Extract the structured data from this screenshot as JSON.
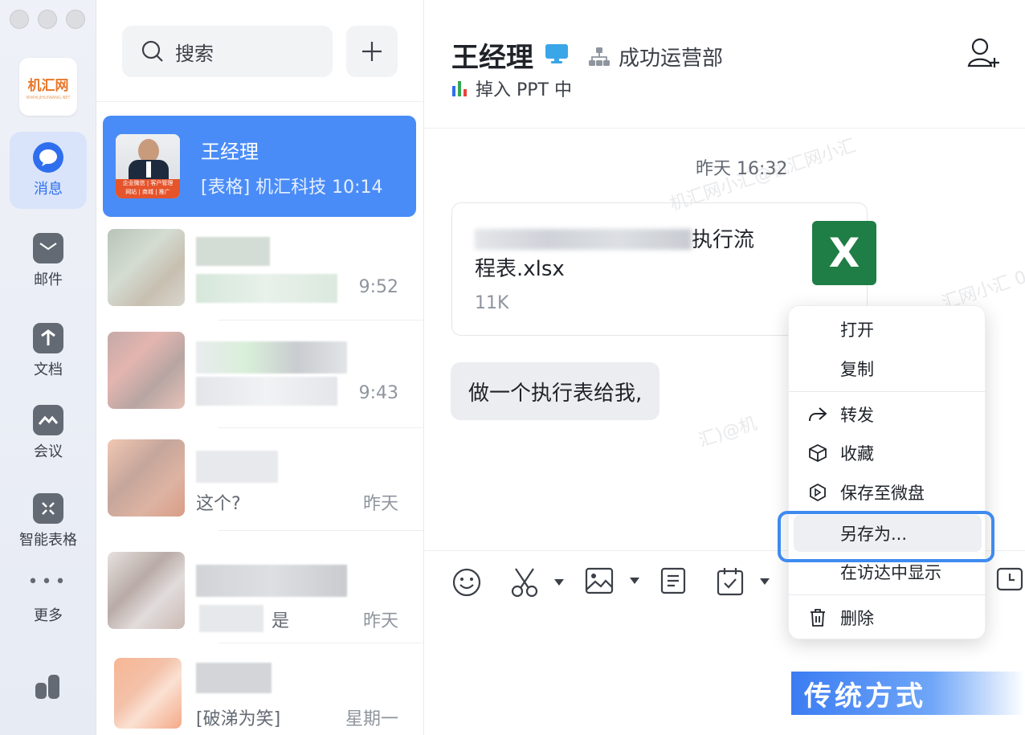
{
  "nav": {
    "logo_text": "机汇网",
    "logo_sub": "WWW.JIHUIWANG.NET",
    "items": [
      {
        "label": "消息",
        "icon": "chat-bubble-icon"
      },
      {
        "label": "邮件",
        "icon": "mail-icon"
      },
      {
        "label": "文档",
        "icon": "document-icon"
      },
      {
        "label": "会议",
        "icon": "meeting-icon"
      },
      {
        "label": "智能表格",
        "icon": "smart-sheet-icon"
      },
      {
        "label": "更多",
        "icon": "more-icon"
      }
    ]
  },
  "list": {
    "search_label": "搜索",
    "conversations": [
      {
        "name": "王经理",
        "preview": "[表格] 机汇科技 10:14",
        "time": ""
      },
      {
        "name": "",
        "preview": "",
        "time": "9:52"
      },
      {
        "name": "",
        "preview": "",
        "time": "9:43"
      },
      {
        "name": "",
        "preview": "这个?",
        "time": "昨天"
      },
      {
        "name": "",
        "preview": "是",
        "time": "昨天"
      },
      {
        "name": "",
        "preview": "[破涕为笑]",
        "time": "星期一"
      }
    ],
    "active_avatar_caption_1": "企业微信 | 客户管理",
    "active_avatar_caption_2": "网站 | 商城 | 推广"
  },
  "chat": {
    "contact_name": "王经理",
    "department": "成功运营部",
    "status": "掉入 PPT 中",
    "timestamp": "昨天 16:32",
    "file": {
      "name_suffix": "执行流",
      "name_line2": "程表.xlsx",
      "size": "11K",
      "icon_letter": "X"
    },
    "message": "做一个执行表给我,"
  },
  "context_menu": {
    "items": [
      {
        "label": "打开"
      },
      {
        "label": "复制"
      },
      {
        "label": "转发",
        "icon": "forward-icon"
      },
      {
        "label": "收藏",
        "icon": "favorite-box-icon"
      },
      {
        "label": "保存至微盘",
        "icon": "weidisk-icon"
      },
      {
        "label": "另存为..."
      },
      {
        "label": "在访达中显示"
      },
      {
        "label": "删除",
        "icon": "trash-icon"
      }
    ]
  },
  "overlay_label": "传统方式",
  "colors": {
    "accent": "#4a8cf7",
    "excel_green": "#1e7e45",
    "highlight_border": "#3e8bf0"
  }
}
